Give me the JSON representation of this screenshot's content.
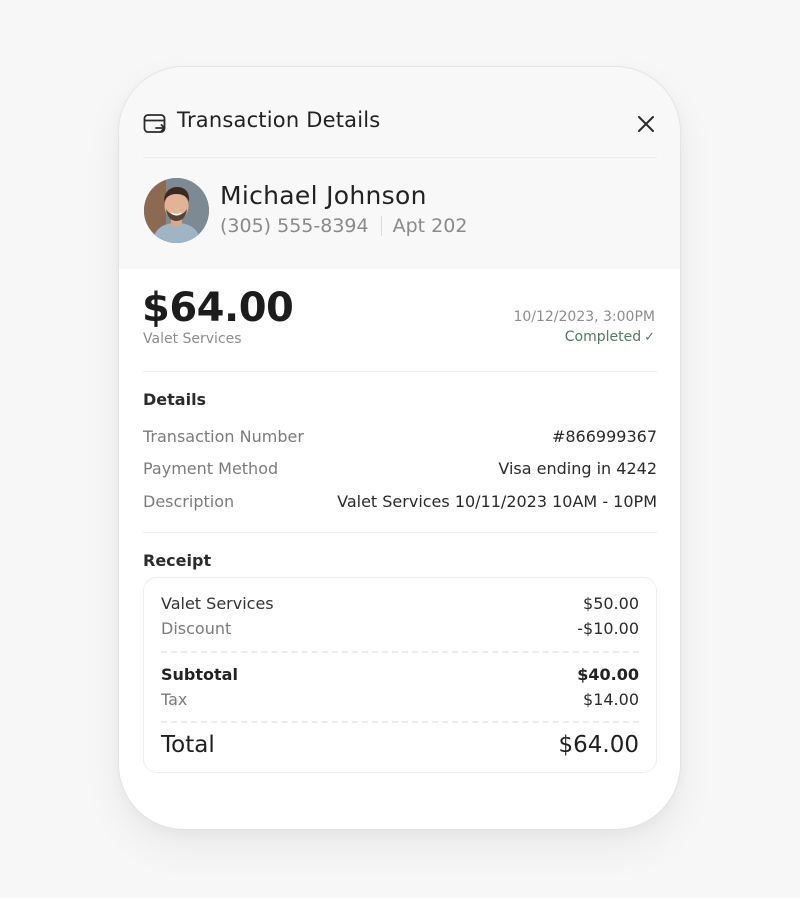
{
  "header": {
    "title": "Transaction Details",
    "icon": "card-transfer-icon",
    "close_icon": "close-icon"
  },
  "customer": {
    "name": "Michael Johnson",
    "phone": "(305) 555-8394",
    "unit": "Apt 202"
  },
  "summary": {
    "amount": "$64.00",
    "service": "Valet Services",
    "datetime": "10/12/2023, 3:00PM",
    "status": "Completed",
    "status_icon": "✓"
  },
  "details": {
    "title": "Details",
    "rows": [
      {
        "label": "Transaction Number",
        "value": "#866999367"
      },
      {
        "label": "Payment Method",
        "value": "Visa ending in 4242"
      },
      {
        "label": "Description",
        "value": "Valet Services 10/11/2023 10AM - 10PM"
      }
    ]
  },
  "receipt": {
    "title": "Receipt",
    "items": [
      {
        "label": "Valet Services",
        "value": "$50.00"
      },
      {
        "label": "Discount",
        "value": "-$10.00"
      }
    ],
    "subtotal": {
      "label": "Subtotal",
      "value": "$40.00"
    },
    "tax": {
      "label": "Tax",
      "value": "$14.00"
    },
    "total": {
      "label": "Total",
      "value": "$64.00"
    }
  },
  "colors": {
    "page_bg": "#f7f7f7",
    "header_bg": "#f8f8f8",
    "status_green": "#4f7a5d",
    "text_primary": "#222222",
    "text_muted": "#8a8a8a"
  }
}
